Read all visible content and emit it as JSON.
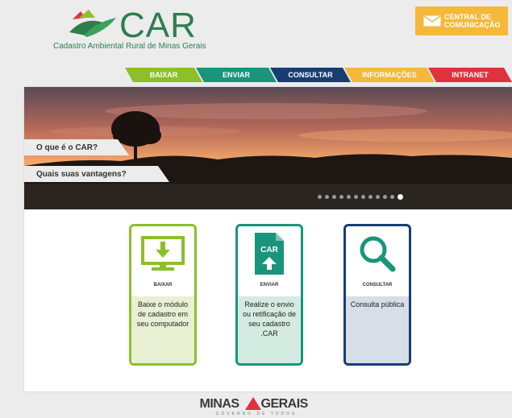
{
  "header": {
    "logo_text": "CAR",
    "logo_subtitle": "Cadastro Ambiental Rural de Minas Gerais",
    "central_label": "CENTRAL DE COMUNICAÇÃO"
  },
  "nav": {
    "tabs": [
      {
        "label": "BAIXAR",
        "color": "#8dbf2a"
      },
      {
        "label": "ENVIAR",
        "color": "#18957a"
      },
      {
        "label": "CONSULTAR",
        "color": "#173e73"
      },
      {
        "label": "INFORMAÇÕES",
        "color": "#f5b83b"
      },
      {
        "label": "INTRANET",
        "color": "#e0323d"
      }
    ]
  },
  "hero": {
    "links": [
      "O que é o CAR?",
      "Quais suas vantagens?"
    ],
    "slide_count": 12,
    "active_slide": 12
  },
  "services": [
    {
      "title": "BAIXAR",
      "description": "Baixe o módulo de cadastro em seu computador",
      "icon": "monitor-download-icon",
      "color": "#8dbf2a"
    },
    {
      "title": "ENVIAR",
      "description": "Realize o envio ou retificação de seu cadastro .CAR",
      "icon": "car-file-upload-icon",
      "icon_text": "CAR",
      "color": "#18957a"
    },
    {
      "title": "CONSULTAR",
      "description": "Consulta pública",
      "icon": "magnifier-icon",
      "color": "#173e73"
    }
  ],
  "footer": {
    "left": "MINAS",
    "right": "GERAIS",
    "subtitle": "GOVERNO DE TODOS"
  }
}
